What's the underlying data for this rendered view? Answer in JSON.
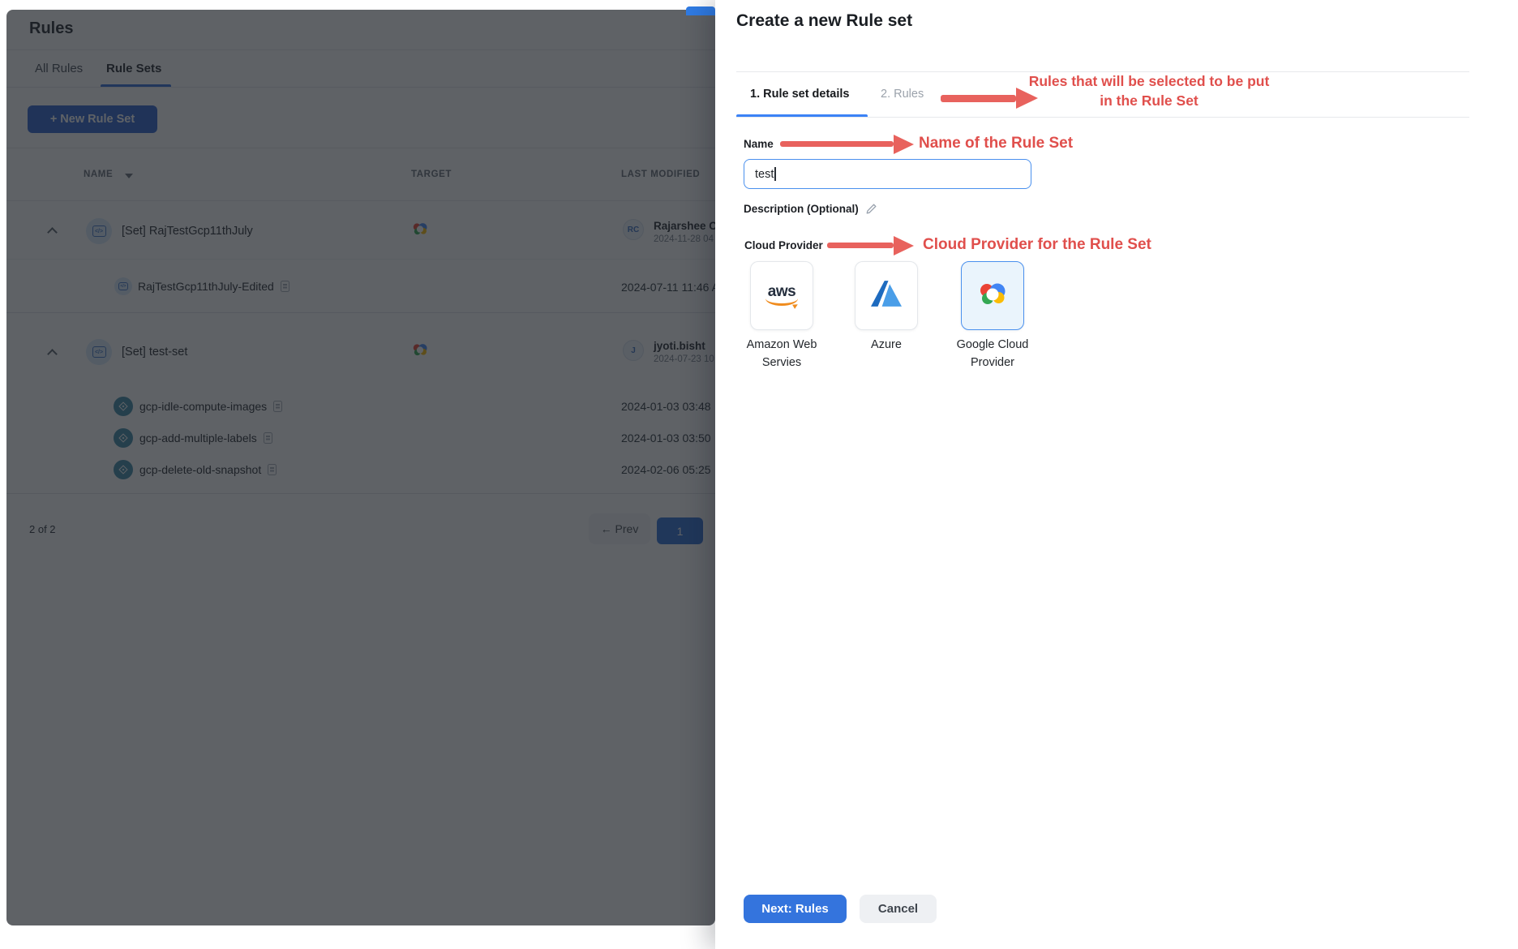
{
  "background": {
    "title": "Rules",
    "tabs": [
      {
        "label": "All Rules",
        "active": false
      },
      {
        "label": "Rule Sets",
        "active": true
      }
    ],
    "new_rule_set_button": "+ New Rule Set",
    "table": {
      "headers": {
        "name": "NAME",
        "target": "TARGET",
        "last_modified": "LAST MODIFIED"
      },
      "groups": [
        {
          "name": "[Set] RajTestGcp11thJuly",
          "target": "google-cloud",
          "modified_initials": "RC",
          "modified_by": "Rajarshee C",
          "modified_date": "2024-11-28 04",
          "children": [
            {
              "name": "RajTestGcp11thJuly-Edited",
              "date": "2024-07-11 11:46 A"
            }
          ]
        },
        {
          "name": "[Set] test-set",
          "target": "google-cloud",
          "modified_initials": "J",
          "modified_by": "jyoti.bisht",
          "modified_date": "2024-07-23 10",
          "children": [
            {
              "name": "gcp-idle-compute-images",
              "date": "2024-01-03 03:48"
            },
            {
              "name": "gcp-add-multiple-labels",
              "date": "2024-01-03 03:50"
            },
            {
              "name": "gcp-delete-old-snapshot",
              "date": "2024-02-06 05:25"
            }
          ]
        }
      ]
    },
    "pagination": {
      "summary": "2 of 2",
      "prev": "← Prev",
      "page": "1"
    }
  },
  "drawer": {
    "title": "Create a new Rule set",
    "steps": [
      {
        "label": "1. Rule set details",
        "active": true
      },
      {
        "label": "2. Rules",
        "active": false
      }
    ],
    "name_label": "Name",
    "name_value": "test",
    "description_label": "Description (Optional)",
    "cloud_provider_label": "Cloud Provider",
    "providers": [
      {
        "label": "Amazon Web Servies",
        "selected": false
      },
      {
        "label": "Azure",
        "selected": false
      },
      {
        "label": "Google Cloud Provider",
        "selected": true
      }
    ],
    "next_button": "Next: Rules",
    "cancel_button": "Cancel"
  },
  "annotations": {
    "rules_tab_line1": "Rules that will be selected to be put",
    "rules_tab_line2": "in the Rule Set",
    "name": "Name of the Rule Set",
    "cloud": "Cloud Provider for the Rule Set",
    "arrow_color": "#e8625d",
    "text_color": "#e04f4c"
  },
  "icons": {
    "ruleset_glyph": "</>"
  },
  "colors": {
    "accent": "#3474dd",
    "tab_underline": "#3b82f6",
    "primary_button": "#2c63cf",
    "dim_overlay": "rgba(27,31,37,0.7)"
  }
}
